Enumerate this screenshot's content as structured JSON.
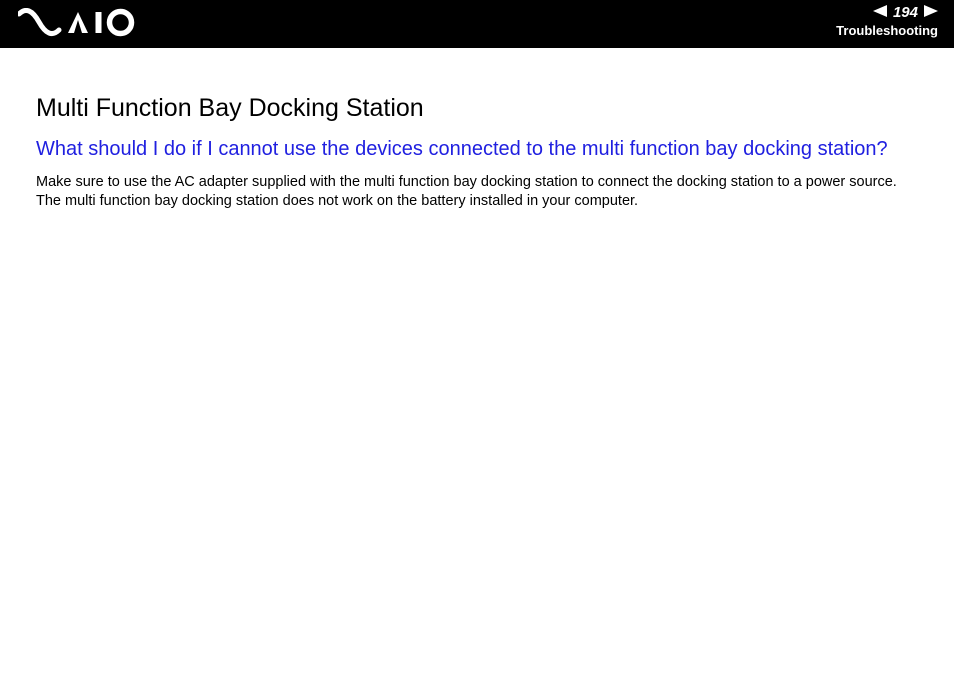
{
  "header": {
    "page_number": "194",
    "section": "Troubleshooting"
  },
  "content": {
    "title": "Multi Function Bay Docking Station",
    "question": "What should I do if I cannot use the devices connected to the multi function bay docking station?",
    "body": "Make sure to use the AC adapter supplied with the multi function bay docking station to connect the docking station to a power source. The multi function bay docking station does not work on the battery installed in your computer."
  }
}
